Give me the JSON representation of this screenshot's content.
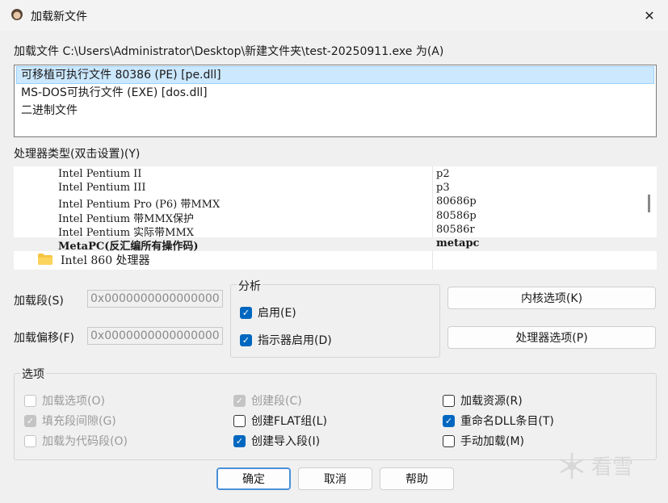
{
  "window": {
    "title": "加载新文件",
    "close_glyph": "✕"
  },
  "load_label": "加载文件 C:\\Users\\Administrator\\Desktop\\新建文件夹\\test-20250911.exe 为(A)",
  "file_types": [
    {
      "label": "可移植可执行文件 80386 (PE) [pe.dll]",
      "selected": true
    },
    {
      "label": "MS-DOS可执行文件 (EXE) [dos.dll]",
      "selected": false
    },
    {
      "label": "二进制文件",
      "selected": false
    }
  ],
  "processor_label": "处理器类型(双击设置)(Y)",
  "processors": [
    {
      "name": "Intel Pentium II",
      "code": "p2"
    },
    {
      "name": "Intel Pentium III",
      "code": "p3"
    },
    {
      "name": "Intel Pentium Pro (P6) 带MMX",
      "code": "80686p"
    },
    {
      "name": "Intel Pentium 带MMX保护",
      "code": "80586p"
    },
    {
      "name": "Intel Pentium 实际带MMX",
      "code": "80586r"
    },
    {
      "name": "MetaPC(反汇编所有操作码)",
      "code": "metapc"
    }
  ],
  "processor_folder": "Intel 860 处理器",
  "load_segment": {
    "label": "加载段(S)",
    "value": "0x0000000000000000"
  },
  "load_offset": {
    "label": "加载偏移(F)",
    "value": "0x0000000000000000"
  },
  "analysis": {
    "title": "分析",
    "enabled": {
      "label": "启用(E)",
      "checked": true
    },
    "indicator": {
      "label": "指示器启用(D)",
      "checked": true
    }
  },
  "buttons": {
    "kernel_options": "内核选项(K)",
    "processor_options": "处理器选项(P)",
    "ok": "确定",
    "cancel": "取消",
    "help": "帮助"
  },
  "options": {
    "title": "选项",
    "load_options": {
      "label": "加载选项(O)",
      "checked": false
    },
    "fill_gaps": {
      "label": "填充段间隙(G)",
      "checked": true
    },
    "load_as_code": {
      "label": "加载为代码段(O)",
      "checked": false
    },
    "create_segments": {
      "label": "创建段(C)",
      "checked": true
    },
    "create_flat": {
      "label": "创建FLAT组(L)",
      "checked": false
    },
    "create_imports": {
      "label": "创建导入段(I)",
      "checked": true
    },
    "load_resources": {
      "label": "加载资源(R)",
      "checked": false
    },
    "rename_dll": {
      "label": "重命名DLL条目(T)",
      "checked": true
    },
    "manual_load": {
      "label": "手动加载(M)",
      "checked": false
    }
  },
  "watermark": "看雪"
}
